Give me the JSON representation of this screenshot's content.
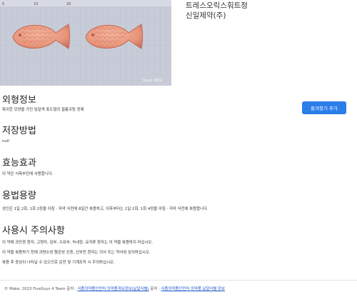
{
  "header": {
    "drug_name": "트레스오릭스훠트정",
    "company": "신일제약(주)",
    "ruler_labels": [
      "0",
      "10",
      "20"
    ],
    "watermark": "Daum 여러도"
  },
  "actions": {
    "favorite_label": "즐겨찾기 추가"
  },
  "sections": {
    "appearance": {
      "title": "외형정보",
      "text": "특이한 모양을 가진 담갈색 표도형의 필름코팅 정제"
    },
    "storage": {
      "title": "저장방법",
      "text": "null"
    },
    "efficacy": {
      "title": "효능효과",
      "text": "이 약은 식욕부진에 사용합니다."
    },
    "dosage": {
      "title": "용법용량",
      "text": "성인은 1일 2회, 1회 2정을 아침 · 저녁 식전에 8일간 복용하고, 이후부터는 1일 2회, 1회 4정을 아침 · 저녁 식전에 복용합니다."
    },
    "precautions": {
      "title": "사용시 주의사항",
      "lines": [
        "이 약에 과민증 환자, 고령자, 임부, 수유부, 녹내장, 요저류 환자는 이 약을 복용하지 마십시오.",
        "이 약을 복용하기 전에 과량소성 혈관성 신증, 신부전 환자는 의사 또는 약사와 상의하십시오.",
        "복용 후 증상이 나타날 수 있으므로 운전 및 기계조작 시 주의하십시오."
      ]
    }
  },
  "footer": {
    "copyright": "© Make, 2023 FiveGuys 4 Team",
    "source_label_1": "출처 :",
    "source_link_1": "식품의약품안전처 의약품개요정보(낱알식별)",
    "source_label_2": "출처 :",
    "source_link_2": "식품의약품안전처 의약품 낱알식별 정보"
  },
  "colors": {
    "accent": "#2b7de9",
    "pill": "#e8957a",
    "background_tray": "#c8ccd8"
  }
}
